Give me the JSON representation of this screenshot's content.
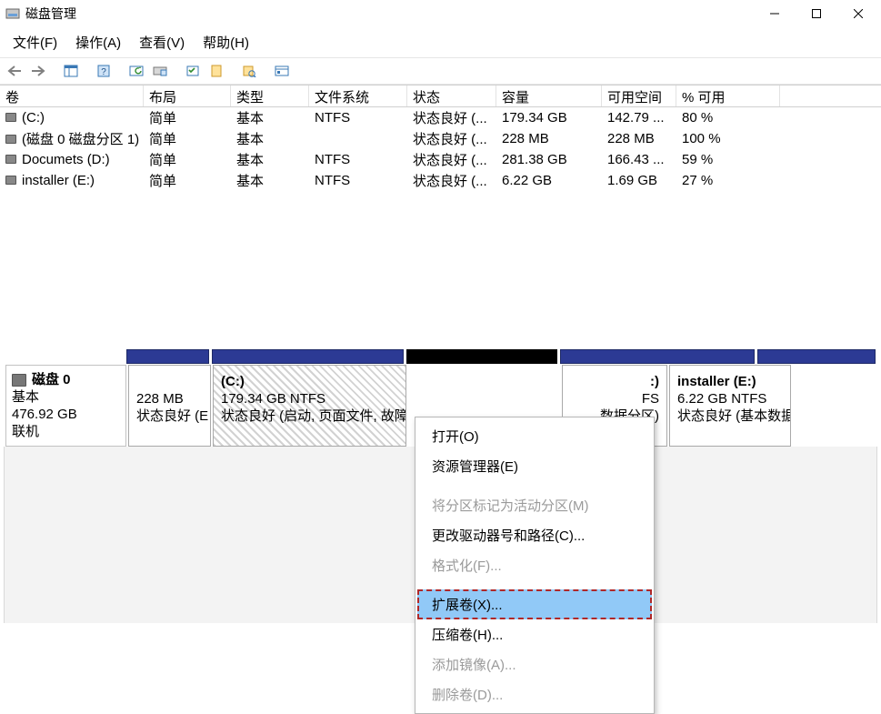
{
  "window": {
    "title": "磁盘管理"
  },
  "menu": {
    "file": "文件(F)",
    "action": "操作(A)",
    "view": "查看(V)",
    "help": "帮助(H)"
  },
  "table": {
    "headers": {
      "volume": "卷",
      "layout": "布局",
      "type": "类型",
      "fs": "文件系统",
      "status": "状态",
      "capacity": "容量",
      "free": "可用空间",
      "pctfree": "% 可用"
    },
    "rows": [
      {
        "name": "(C:)",
        "layout": "简单",
        "type": "基本",
        "fs": "NTFS",
        "status": "状态良好 (...",
        "capacity": "179.34 GB",
        "free": "142.79 ...",
        "pctfree": "80 %"
      },
      {
        "name": "(磁盘 0 磁盘分区 1)",
        "layout": "简单",
        "type": "基本",
        "fs": "",
        "status": "状态良好 (...",
        "capacity": "228 MB",
        "free": "228 MB",
        "pctfree": "100 %"
      },
      {
        "name": "Documets (D:)",
        "layout": "简单",
        "type": "基本",
        "fs": "NTFS",
        "status": "状态良好 (...",
        "capacity": "281.38 GB",
        "free": "166.43 ...",
        "pctfree": "59 %"
      },
      {
        "name": "installer (E:)",
        "layout": "简单",
        "type": "基本",
        "fs": "NTFS",
        "status": "状态良好 (...",
        "capacity": "6.22 GB",
        "free": "1.69 GB",
        "pctfree": "27 %"
      }
    ]
  },
  "disk": {
    "name": "磁盘 0",
    "type": "基本",
    "size": "476.92 GB",
    "state": "联机"
  },
  "parts": {
    "p1": {
      "name": "",
      "l1": "228 MB",
      "l2": "状态良好 (E"
    },
    "p2": {
      "name": "(C:)",
      "l1": "179.34 GB NTFS",
      "l2": "状态良好 (启动, 页面文件, 故障"
    },
    "p3": {
      "name": ":)",
      "l1": "FS",
      "l2": "数据分区)"
    },
    "p4": {
      "name": "installer  (E:)",
      "l1": "6.22 GB NTFS",
      "l2": "状态良好 (基本数据"
    }
  },
  "ctx": {
    "open": "打开(O)",
    "explorer": "资源管理器(E)",
    "markactive": "将分区标记为活动分区(M)",
    "changedrive": "更改驱动器号和路径(C)...",
    "format": "格式化(F)...",
    "extend": "扩展卷(X)...",
    "shrink": "压缩卷(H)...",
    "addmirror": "添加镜像(A)...",
    "delete": "删除卷(D)..."
  }
}
